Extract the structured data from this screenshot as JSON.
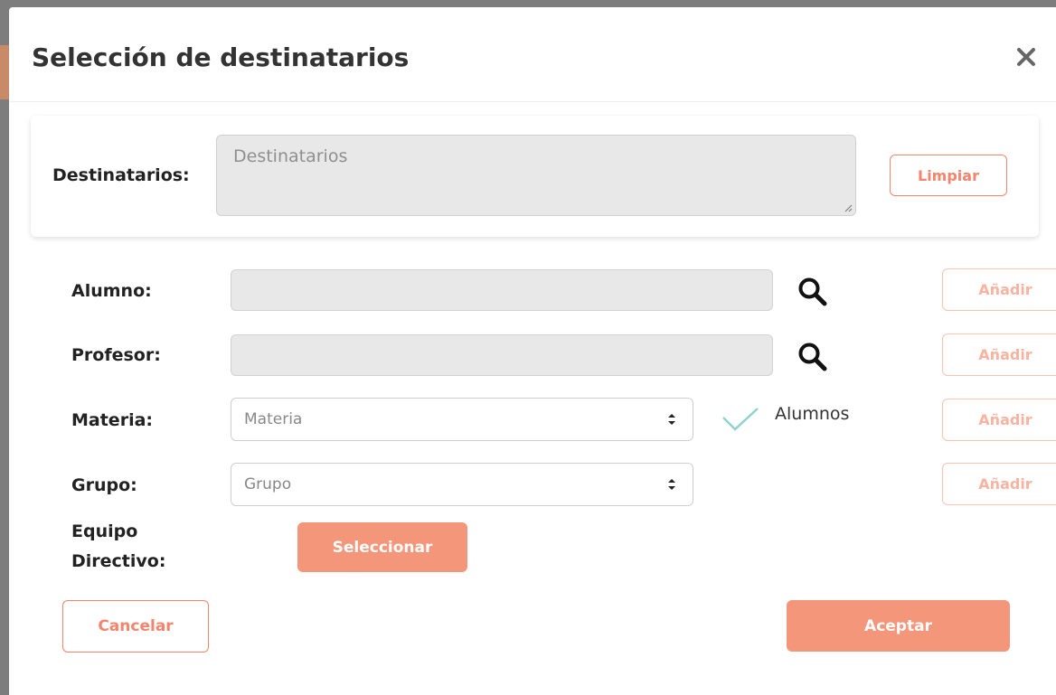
{
  "modal": {
    "title": "Selección de destinatarios",
    "close_icon": "close-icon"
  },
  "recipients": {
    "label": "Destinatarios:",
    "placeholder": "Destinatarios",
    "clear_label": "Limpiar"
  },
  "form": {
    "alumno": {
      "label": "Alumno:",
      "add_label": "Añadir",
      "icon": "search-icon"
    },
    "profesor": {
      "label": "Profesor:",
      "add_label": "Añadir",
      "icon": "search-icon"
    },
    "materia": {
      "label": "Materia:",
      "selected": "Materia",
      "add_label": "Añadir",
      "checkbox_label": "Alumnos",
      "checkbox_checked": true
    },
    "grupo": {
      "label": "Grupo:",
      "selected": "Grupo",
      "add_label": "Añadir"
    },
    "equipo": {
      "label_line1": "Equipo",
      "label_line2": "Directivo:",
      "select_label": "Seleccionar"
    }
  },
  "footer": {
    "cancel_label": "Cancelar",
    "accept_label": "Aceptar"
  },
  "colors": {
    "accent": "#f4846c",
    "accent_fill": "#f4967a",
    "check": "#8fd3d0"
  }
}
